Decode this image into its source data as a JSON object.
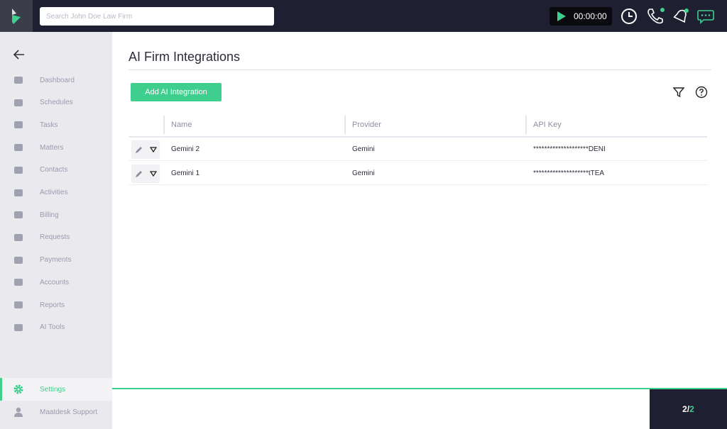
{
  "header": {
    "search_placeholder": "Search John Doe Law Firm",
    "timer": "00:00:00",
    "colors": {
      "dark": "#1e1f30",
      "accent": "#3ecf8e"
    }
  },
  "sidebar": {
    "items": [
      {
        "label": "Dashboard",
        "icon": "home-icon"
      },
      {
        "label": "Schedules",
        "icon": "calendar-icon"
      },
      {
        "label": "Tasks",
        "icon": "list-icon"
      },
      {
        "label": "Matters",
        "icon": "gavel-icon"
      },
      {
        "label": "Contacts",
        "icon": "user-icon"
      },
      {
        "label": "Activities",
        "icon": "clock-icon"
      },
      {
        "label": "Billing",
        "icon": "money-icon"
      },
      {
        "label": "Requests",
        "icon": "hand-icon"
      },
      {
        "label": "Payments",
        "icon": "dollar-icon"
      },
      {
        "label": "Accounts",
        "icon": "bank-icon"
      },
      {
        "label": "Reports",
        "icon": "bar-chart-icon"
      },
      {
        "label": "AI Tools",
        "icon": "sparkle-icon"
      }
    ],
    "settings": "Settings",
    "support": "Maatdesk Support"
  },
  "page": {
    "title": "AI Firm Integrations",
    "add_button": "Add AI Integration"
  },
  "table": {
    "columns": [
      "Name",
      "Provider",
      "API Key"
    ],
    "rows": [
      {
        "name": "Gemini 2",
        "provider": "Gemini",
        "api_key": "********************DENI"
      },
      {
        "name": "Gemini 1",
        "provider": "Gemini",
        "api_key": "********************tTEA"
      }
    ]
  },
  "pager": {
    "current": "2",
    "sep": "/",
    "total": "2"
  }
}
